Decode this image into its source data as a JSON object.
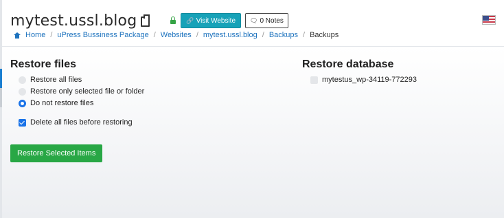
{
  "header": {
    "site_title": "mytest.ussl.blog",
    "visit_button_label": "Visit Website",
    "notes_button_label": "0 Notes"
  },
  "breadcrumb": {
    "items": [
      "Home",
      "uPress Bussiness Package",
      "Websites",
      "mytest.ussl.blog",
      "Backups"
    ],
    "current": "Backups"
  },
  "restore_files": {
    "title": "Restore files",
    "options": [
      {
        "label": "Restore all files",
        "selected": false
      },
      {
        "label": "Restore only selected file or folder",
        "selected": false
      },
      {
        "label": "Do not restore files",
        "selected": true
      }
    ],
    "delete_all_label": "Delete all files before restoring",
    "delete_all_checked": true
  },
  "restore_database": {
    "title": "Restore database",
    "databases": [
      {
        "label": "mytestus_wp-34119-772293",
        "checked": false
      }
    ]
  },
  "actions": {
    "restore_button_label": "Restore Selected Items"
  },
  "colors": {
    "accent_blue": "#1a73e8",
    "visit_button": "#17a2b8",
    "restore_button": "#28a745",
    "link": "#1e73be"
  }
}
